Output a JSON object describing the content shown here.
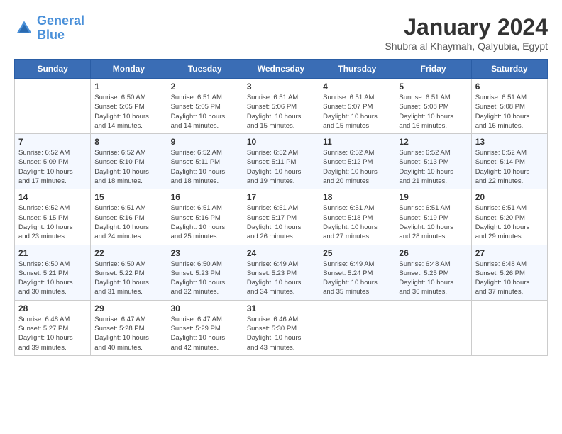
{
  "header": {
    "logo_line1": "General",
    "logo_line2": "Blue",
    "month": "January 2024",
    "location": "Shubra al Khaymah, Qalyubia, Egypt"
  },
  "days_of_week": [
    "Sunday",
    "Monday",
    "Tuesday",
    "Wednesday",
    "Thursday",
    "Friday",
    "Saturday"
  ],
  "weeks": [
    [
      {
        "day": "",
        "info": ""
      },
      {
        "day": "1",
        "info": "Sunrise: 6:50 AM\nSunset: 5:05 PM\nDaylight: 10 hours\nand 14 minutes."
      },
      {
        "day": "2",
        "info": "Sunrise: 6:51 AM\nSunset: 5:05 PM\nDaylight: 10 hours\nand 14 minutes."
      },
      {
        "day": "3",
        "info": "Sunrise: 6:51 AM\nSunset: 5:06 PM\nDaylight: 10 hours\nand 15 minutes."
      },
      {
        "day": "4",
        "info": "Sunrise: 6:51 AM\nSunset: 5:07 PM\nDaylight: 10 hours\nand 15 minutes."
      },
      {
        "day": "5",
        "info": "Sunrise: 6:51 AM\nSunset: 5:08 PM\nDaylight: 10 hours\nand 16 minutes."
      },
      {
        "day": "6",
        "info": "Sunrise: 6:51 AM\nSunset: 5:08 PM\nDaylight: 10 hours\nand 16 minutes."
      }
    ],
    [
      {
        "day": "7",
        "info": "Sunrise: 6:52 AM\nSunset: 5:09 PM\nDaylight: 10 hours\nand 17 minutes."
      },
      {
        "day": "8",
        "info": "Sunrise: 6:52 AM\nSunset: 5:10 PM\nDaylight: 10 hours\nand 18 minutes."
      },
      {
        "day": "9",
        "info": "Sunrise: 6:52 AM\nSunset: 5:11 PM\nDaylight: 10 hours\nand 18 minutes."
      },
      {
        "day": "10",
        "info": "Sunrise: 6:52 AM\nSunset: 5:11 PM\nDaylight: 10 hours\nand 19 minutes."
      },
      {
        "day": "11",
        "info": "Sunrise: 6:52 AM\nSunset: 5:12 PM\nDaylight: 10 hours\nand 20 minutes."
      },
      {
        "day": "12",
        "info": "Sunrise: 6:52 AM\nSunset: 5:13 PM\nDaylight: 10 hours\nand 21 minutes."
      },
      {
        "day": "13",
        "info": "Sunrise: 6:52 AM\nSunset: 5:14 PM\nDaylight: 10 hours\nand 22 minutes."
      }
    ],
    [
      {
        "day": "14",
        "info": "Sunrise: 6:52 AM\nSunset: 5:15 PM\nDaylight: 10 hours\nand 23 minutes."
      },
      {
        "day": "15",
        "info": "Sunrise: 6:51 AM\nSunset: 5:16 PM\nDaylight: 10 hours\nand 24 minutes."
      },
      {
        "day": "16",
        "info": "Sunrise: 6:51 AM\nSunset: 5:16 PM\nDaylight: 10 hours\nand 25 minutes."
      },
      {
        "day": "17",
        "info": "Sunrise: 6:51 AM\nSunset: 5:17 PM\nDaylight: 10 hours\nand 26 minutes."
      },
      {
        "day": "18",
        "info": "Sunrise: 6:51 AM\nSunset: 5:18 PM\nDaylight: 10 hours\nand 27 minutes."
      },
      {
        "day": "19",
        "info": "Sunrise: 6:51 AM\nSunset: 5:19 PM\nDaylight: 10 hours\nand 28 minutes."
      },
      {
        "day": "20",
        "info": "Sunrise: 6:51 AM\nSunset: 5:20 PM\nDaylight: 10 hours\nand 29 minutes."
      }
    ],
    [
      {
        "day": "21",
        "info": "Sunrise: 6:50 AM\nSunset: 5:21 PM\nDaylight: 10 hours\nand 30 minutes."
      },
      {
        "day": "22",
        "info": "Sunrise: 6:50 AM\nSunset: 5:22 PM\nDaylight: 10 hours\nand 31 minutes."
      },
      {
        "day": "23",
        "info": "Sunrise: 6:50 AM\nSunset: 5:23 PM\nDaylight: 10 hours\nand 32 minutes."
      },
      {
        "day": "24",
        "info": "Sunrise: 6:49 AM\nSunset: 5:23 PM\nDaylight: 10 hours\nand 34 minutes."
      },
      {
        "day": "25",
        "info": "Sunrise: 6:49 AM\nSunset: 5:24 PM\nDaylight: 10 hours\nand 35 minutes."
      },
      {
        "day": "26",
        "info": "Sunrise: 6:48 AM\nSunset: 5:25 PM\nDaylight: 10 hours\nand 36 minutes."
      },
      {
        "day": "27",
        "info": "Sunrise: 6:48 AM\nSunset: 5:26 PM\nDaylight: 10 hours\nand 37 minutes."
      }
    ],
    [
      {
        "day": "28",
        "info": "Sunrise: 6:48 AM\nSunset: 5:27 PM\nDaylight: 10 hours\nand 39 minutes."
      },
      {
        "day": "29",
        "info": "Sunrise: 6:47 AM\nSunset: 5:28 PM\nDaylight: 10 hours\nand 40 minutes."
      },
      {
        "day": "30",
        "info": "Sunrise: 6:47 AM\nSunset: 5:29 PM\nDaylight: 10 hours\nand 42 minutes."
      },
      {
        "day": "31",
        "info": "Sunrise: 6:46 AM\nSunset: 5:30 PM\nDaylight: 10 hours\nand 43 minutes."
      },
      {
        "day": "",
        "info": ""
      },
      {
        "day": "",
        "info": ""
      },
      {
        "day": "",
        "info": ""
      }
    ]
  ]
}
